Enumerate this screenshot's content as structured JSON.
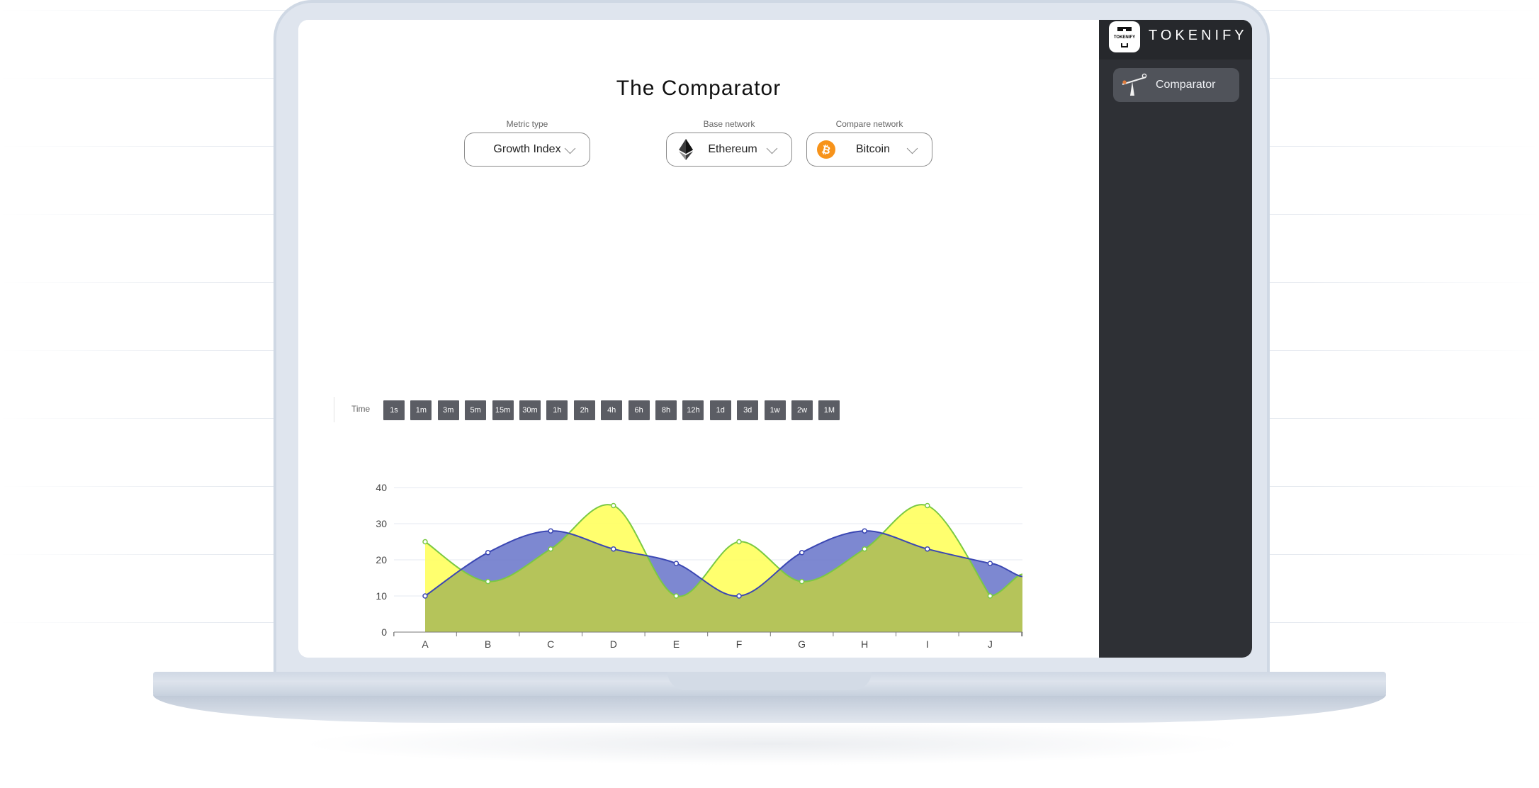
{
  "app": {
    "brand": "TOKENIFY",
    "logo_text": "TOKENIFY"
  },
  "page": {
    "title": "The Comparator"
  },
  "selectors": {
    "metric": {
      "label": "Metric type",
      "value": "Growth Index"
    },
    "base": {
      "label": "Base network",
      "value": "Ethereum",
      "icon": "ethereum-icon"
    },
    "compare": {
      "label": "Compare network",
      "value": "Bitcoin",
      "icon": "bitcoin-icon"
    }
  },
  "time": {
    "label": "Time",
    "options": [
      "1s",
      "1m",
      "3m",
      "5m",
      "15m",
      "30m",
      "1h",
      "2h",
      "4h",
      "6h",
      "8h",
      "12h",
      "1d",
      "3d",
      "1w",
      "2w",
      "1M"
    ]
  },
  "sidebar": {
    "items": [
      {
        "label": "Comparator",
        "icon": "seesaw-icon"
      }
    ]
  },
  "colors": {
    "series_a_fill": "#ffff66",
    "series_a_line": "#7ac943",
    "series_b_fill": "#6f7bcc",
    "series_b_line": "#3b47b3",
    "overlap": "#b5c45a",
    "sidebar_bg": "#2e3035",
    "time_button": "#5b5d64"
  },
  "chart_data": {
    "type": "area",
    "categories": [
      "A",
      "B",
      "C",
      "D",
      "E",
      "F",
      "G",
      "H",
      "I",
      "J"
    ],
    "ylim": [
      0,
      40
    ],
    "yticks": [
      0,
      10,
      20,
      30,
      40
    ],
    "grid": true,
    "series": [
      {
        "values": [
          25,
          14,
          23,
          35,
          10,
          25,
          14,
          23,
          35,
          10
        ]
      },
      {
        "values": [
          10,
          22,
          28,
          23,
          19,
          10,
          22,
          28,
          23,
          19
        ]
      }
    ]
  }
}
